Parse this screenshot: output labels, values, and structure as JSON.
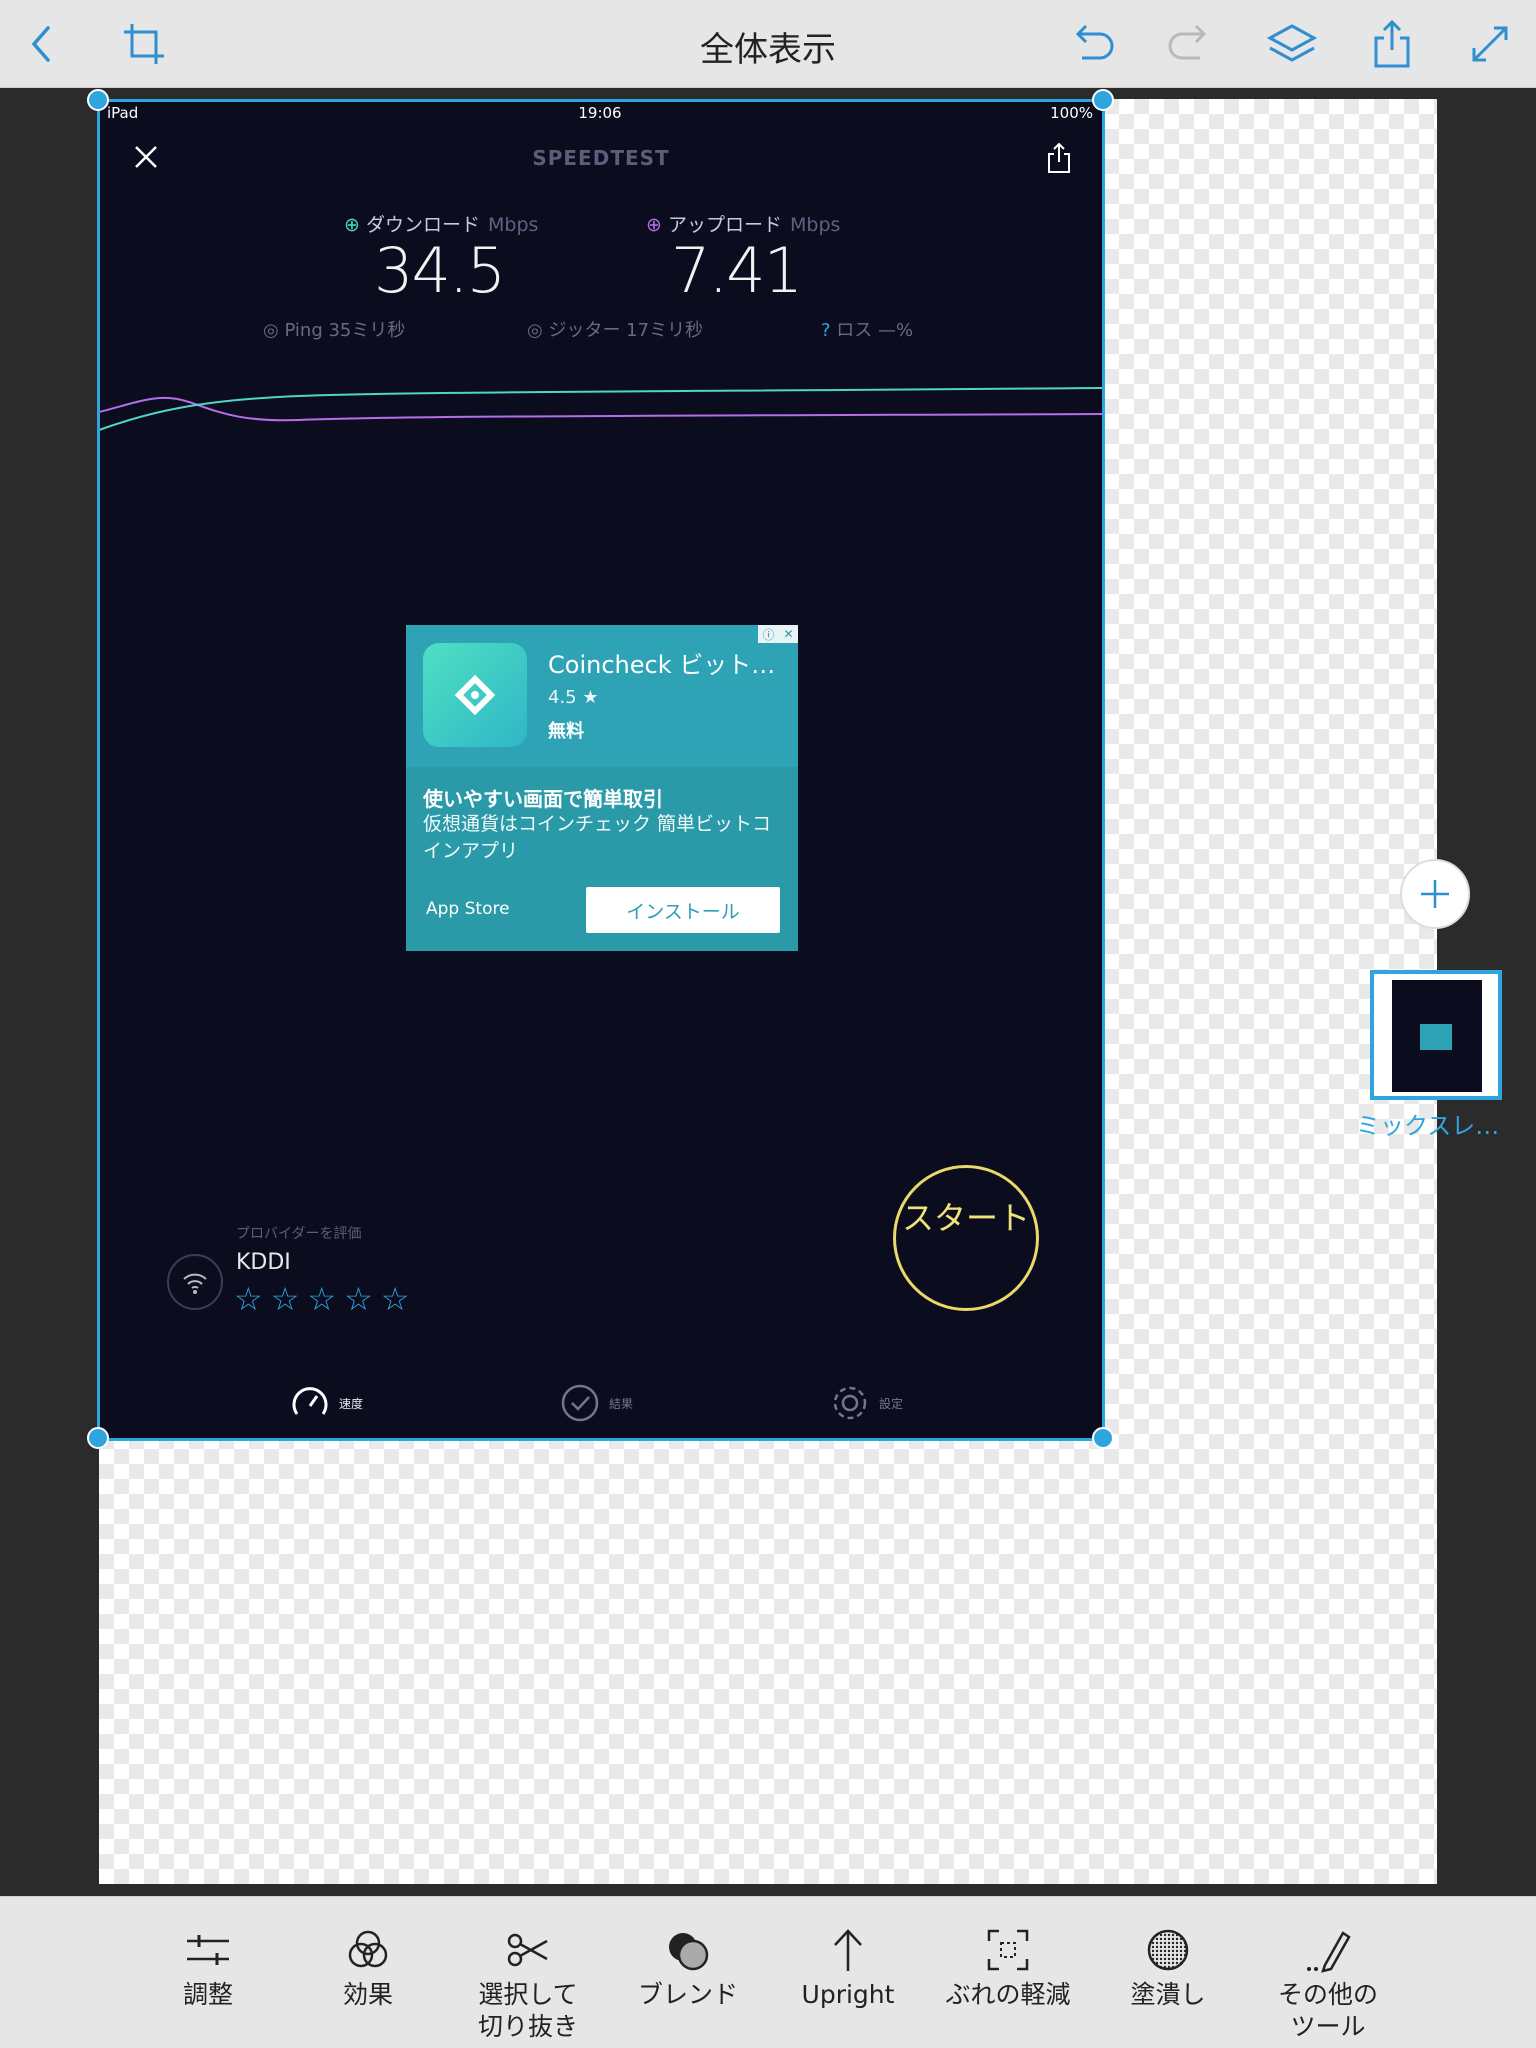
{
  "topbar": {
    "title": "全体表示",
    "icons": [
      "back-icon",
      "crop-icon",
      "undo-icon",
      "redo-icon",
      "layers-icon",
      "share-icon",
      "expand-icon"
    ]
  },
  "speedtest": {
    "status": {
      "device": "iPad",
      "time": "19:06",
      "battery": "100%"
    },
    "logo": "SPEEDTEST",
    "download": {
      "label": "ダウンロード",
      "unit": "Mbps",
      "value": "34.5"
    },
    "upload": {
      "label": "アップロード",
      "unit": "Mbps",
      "value": "7.41"
    },
    "ping": "Ping  35ミリ秒",
    "jitter": "ジッター  17ミリ秒",
    "loss": "ロス  —%",
    "ad": {
      "app_name": "Coincheck ビット…",
      "rating": "4.5",
      "price": "無料",
      "headline": "使いやすい画面で簡単取引",
      "description": "仮想通貨はコインチェック 簡単ビットコインアプリ",
      "store": "App Store",
      "install": "インストール"
    },
    "provider": {
      "rate_label": "プロバイダーを評価",
      "name": "KDDI",
      "stars": 0
    },
    "start": "スタート",
    "tabs": {
      "speed": "速度",
      "results": "結果",
      "settings": "設定"
    },
    "colors": {
      "download": "#4fd6c6",
      "upload": "#b46ee8",
      "accent": "#2fa5e0",
      "start": "#e9d96a"
    }
  },
  "layers": {
    "label": "ミックスレ…"
  },
  "tools": [
    {
      "label": "調整",
      "icon": "sliders-icon"
    },
    {
      "label": "効果",
      "icon": "effects-icon"
    },
    {
      "label": "選択して\n切り抜き",
      "icon": "scissors-icon"
    },
    {
      "label": "ブレンド",
      "icon": "blend-icon"
    },
    {
      "label": "Upright",
      "icon": "upright-icon"
    },
    {
      "label": "ぶれの軽減",
      "icon": "shake-reduction-icon"
    },
    {
      "label": "塗潰し",
      "icon": "fill-icon"
    },
    {
      "label": "その他の\nツール",
      "icon": "more-tools-icon"
    }
  ]
}
